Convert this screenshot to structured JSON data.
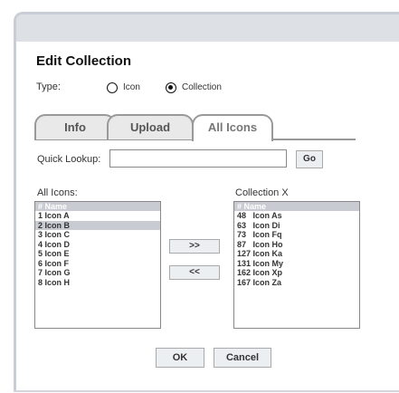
{
  "dialog": {
    "title": "Edit Collection"
  },
  "type": {
    "label": "Type:",
    "options": [
      {
        "label": "Icon",
        "selected": false
      },
      {
        "label": "Collection",
        "selected": true
      }
    ]
  },
  "tabs": [
    {
      "label": "Info",
      "active": false
    },
    {
      "label": "Upload",
      "active": false
    },
    {
      "label": "All Icons",
      "active": true
    }
  ],
  "lookup": {
    "label": "Quick Lookup:",
    "value": "",
    "button": "Go"
  },
  "all_icons": {
    "label": "All Icons:",
    "header": "# Name",
    "rows": [
      "1 Icon A",
      "2 Icon B",
      "3 Icon C",
      "4 Icon D",
      "5 Icon E",
      "6 Icon F",
      "7 Icon G",
      "8 Icon H"
    ],
    "selected_index": 1
  },
  "collection": {
    "label": "Collection X",
    "header": "# Name",
    "rows": [
      "48   Icon As",
      "63   Icon Di",
      "73   Icon Fq",
      "87   Icon Ho",
      "127 Icon Ka",
      "131 Icon My",
      "162 Icon Xp",
      "167 Icon Za"
    ]
  },
  "move": {
    "add": ">>",
    "remove": "<<"
  },
  "footer": {
    "ok": "OK",
    "cancel": "Cancel"
  },
  "colors": {
    "frame": "#c9ced6",
    "header": "#dde1e6",
    "selection": "#c8ccd2"
  }
}
